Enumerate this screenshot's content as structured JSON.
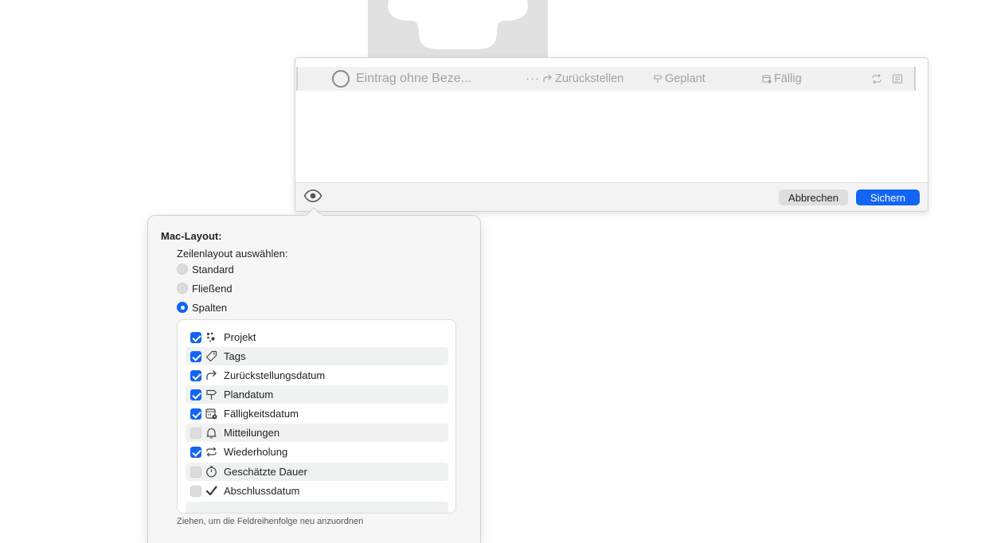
{
  "entry": {
    "placeholder": "Eintrag ohne Beze...",
    "more": "···",
    "defer_label": "Zurückstellen",
    "planned_label": "Geplant",
    "due_label": "Fällig"
  },
  "footer": {
    "cancel_label": "Abbrechen",
    "save_label": "Sichern"
  },
  "popover": {
    "title": "Mac-Layout:",
    "subtitle": "Zeilenlayout auswählen:",
    "layouts": [
      {
        "label": "Standard",
        "selected": false
      },
      {
        "label": "Fließend",
        "selected": false
      },
      {
        "label": "Spalten",
        "selected": true
      }
    ],
    "fields": [
      {
        "label": "Projekt",
        "checked": true,
        "icon": "project-icon"
      },
      {
        "label": "Tags",
        "checked": true,
        "icon": "tag-icon"
      },
      {
        "label": "Zurückstellungsdatum",
        "checked": true,
        "icon": "defer-arrow-icon"
      },
      {
        "label": "Plandatum",
        "checked": true,
        "icon": "signpost-icon"
      },
      {
        "label": "Fälligkeitsdatum",
        "checked": true,
        "icon": "due-calendar-icon"
      },
      {
        "label": "Mitteilungen",
        "checked": false,
        "icon": "bell-icon"
      },
      {
        "label": "Wiederholung",
        "checked": true,
        "icon": "repeat-icon"
      },
      {
        "label": "Geschätzte Dauer",
        "checked": false,
        "icon": "timer-icon"
      },
      {
        "label": "Abschlussdatum",
        "checked": false,
        "icon": "checkmark-icon"
      }
    ],
    "hint": "Ziehen, um die Feldreihenfolge neu anzuordnen"
  },
  "colors": {
    "accent": "#1264f5",
    "placeholder_text": "#a2a2a2",
    "popover_bg": "#f6f6f6"
  }
}
